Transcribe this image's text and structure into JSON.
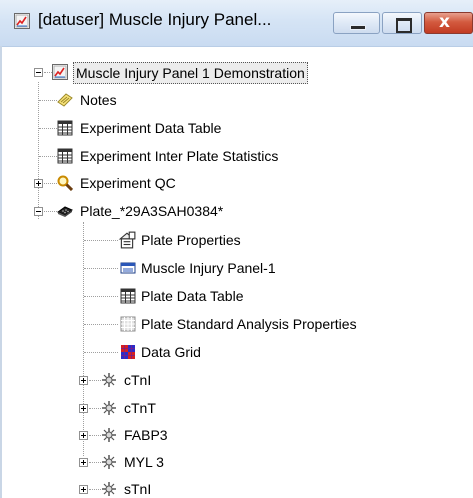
{
  "window": {
    "title": "[datuser] Muscle Injury Panel...",
    "title_icon": "panel-chart-icon"
  },
  "caption_buttons": {
    "minimize_icon": "minimize-icon",
    "maximize_icon": "maximize-icon",
    "close_glyph": "x",
    "close_icon": "close-icon"
  },
  "tree": {
    "root": {
      "label": "Muscle Injury Panel 1 Demonstration",
      "icon": "panel-chart-icon",
      "expanded": true
    },
    "items": [
      {
        "label": "Notes",
        "icon": "notes-icon"
      },
      {
        "label": "Experiment Data Table",
        "icon": "table-icon"
      },
      {
        "label": "Experiment Inter Plate Statistics",
        "icon": "table-icon"
      },
      {
        "label": "Experiment QC",
        "icon": "magnifier-icon",
        "expandable": true
      },
      {
        "label": "Plate_*29A3SAH0384*",
        "icon": "plate-icon",
        "expanded": true
      }
    ],
    "plate_children": [
      {
        "label": "Plate Properties",
        "icon": "properties-icon"
      },
      {
        "label": "Muscle Injury Panel-1",
        "icon": "layout-icon"
      },
      {
        "label": "Plate Data Table",
        "icon": "table-icon"
      },
      {
        "label": "Plate Standard Analysis Properties",
        "icon": "analysis-grid-icon"
      },
      {
        "label": "Data Grid",
        "icon": "data-grid-icon"
      },
      {
        "label": "cTnI",
        "icon": "analyte-icon",
        "expandable": true
      },
      {
        "label": "cTnT",
        "icon": "analyte-icon",
        "expandable": true
      },
      {
        "label": "FABP3",
        "icon": "analyte-icon",
        "expandable": true
      },
      {
        "label": "MYL 3",
        "icon": "analyte-icon",
        "expandable": true
      },
      {
        "label": "sTnI",
        "icon": "analyte-icon",
        "expandable": true
      }
    ]
  },
  "colors": {
    "titlebar": "#d5e4f5",
    "close_button": "#c23b22",
    "selection_background": "#ececec"
  }
}
